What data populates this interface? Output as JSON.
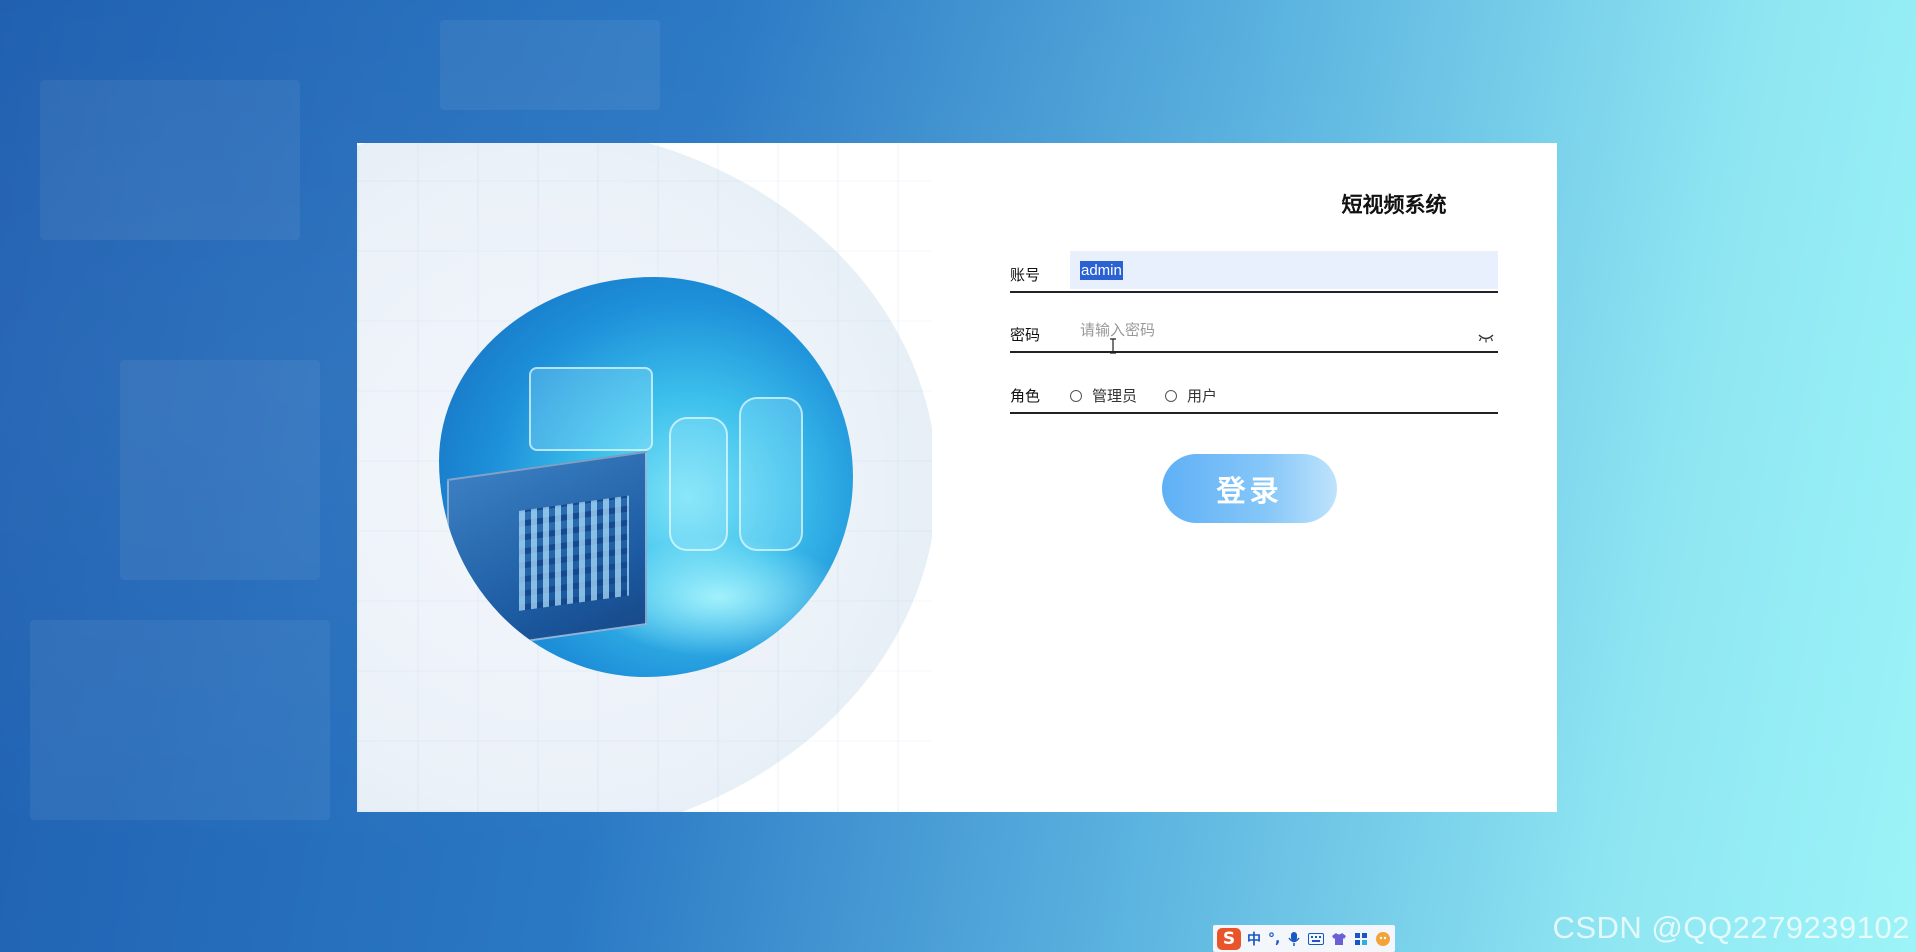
{
  "login": {
    "title": "短视频系统",
    "account_label": "账号",
    "account_value": "admin",
    "password_label": "密码",
    "password_placeholder": "请输入密码",
    "role_label": "角色",
    "role_options": [
      "管理员",
      "用户"
    ],
    "submit_label": "登录"
  },
  "colors": {
    "button_gradient_start": "#5fb0f6",
    "background_left": "#1f5fb0",
    "background_right": "#9cf4f8",
    "autofill_bg": "#e8f0fe"
  },
  "taskbar_ime": {
    "logo": "S",
    "mode": "中",
    "punct": "°,",
    "icons": [
      "mic-icon",
      "keyboard-icon",
      "shirt-icon",
      "apps-icon",
      "face-icon"
    ]
  },
  "watermark": "CSDN @QQ2279239102"
}
